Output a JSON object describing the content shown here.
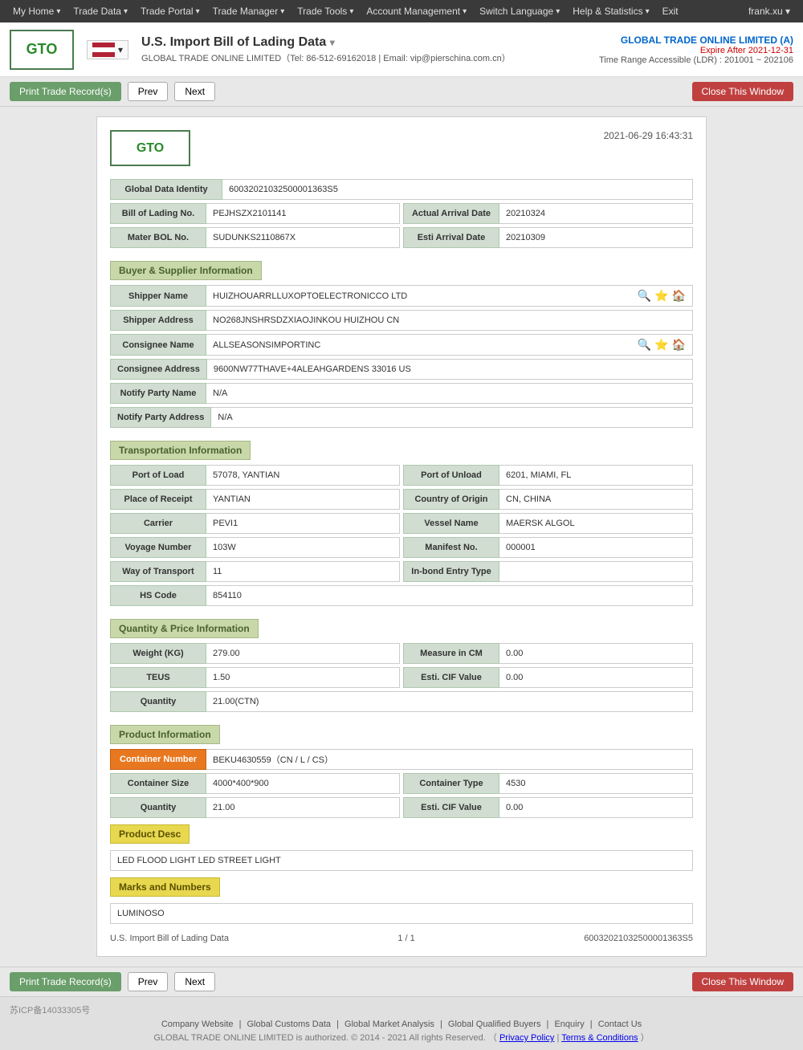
{
  "nav": {
    "items": [
      {
        "label": "My Home",
        "id": "my-home"
      },
      {
        "label": "Trade Data",
        "id": "trade-data"
      },
      {
        "label": "Trade Portal",
        "id": "trade-portal"
      },
      {
        "label": "Trade Manager",
        "id": "trade-manager"
      },
      {
        "label": "Trade Tools",
        "id": "trade-tools"
      },
      {
        "label": "Account Management",
        "id": "account-management"
      },
      {
        "label": "Switch Language",
        "id": "switch-language"
      },
      {
        "label": "Help & Statistics",
        "id": "help-statistics"
      },
      {
        "label": "Exit",
        "id": "exit"
      }
    ],
    "user": "frank.xu ▾"
  },
  "header": {
    "logo_line1": "GTO",
    "logo_line2": "GLOBAL TRADE\nONLINE LIMITED",
    "title": "U.S. Import Bill of Lading Data",
    "subtitle": "GLOBAL TRADE ONLINE LIMITED（Tel: 86-512-69162018 | Email: vip@pierschina.com.cn）",
    "company": "GLOBAL TRADE ONLINE LIMITED (A)",
    "expire": "Expire After 2021-12-31",
    "time_range": "Time Range Accessible (LDR) : 201001 ~ 202106"
  },
  "toolbar": {
    "print_label": "Print Trade Record(s)",
    "prev_label": "Prev",
    "next_label": "Next",
    "close_label": "Close This Window"
  },
  "record": {
    "date": "2021-06-29 16:43:31",
    "global_data_identity_label": "Global Data Identity",
    "global_data_identity_value": "60032021032500001363S5",
    "bill_of_lading_no_label": "Bill of Lading No.",
    "bill_of_lading_no_value": "PEJHSZX2101141",
    "actual_arrival_date_label": "Actual Arrival Date",
    "actual_arrival_date_value": "20210324",
    "mater_bol_no_label": "Mater BOL No.",
    "mater_bol_no_value": "SUDUNKS2110867X",
    "esti_arrival_date_label": "Esti Arrival Date",
    "esti_arrival_date_value": "20210309",
    "sections": {
      "buyer_supplier": "Buyer & Supplier Information",
      "transportation": "Transportation Information",
      "quantity_price": "Quantity & Price Information",
      "product": "Product Information"
    },
    "shipper_name_label": "Shipper Name",
    "shipper_name_value": "HUIZHOUARRLLUXOPTOELECTRONICCO LTD",
    "shipper_address_label": "Shipper Address",
    "shipper_address_value": "NO268JNSHRSDZXIAOJINKOU HUIZHOU CN",
    "consignee_name_label": "Consignee Name",
    "consignee_name_value": "ALLSEASONSIMPORTINC",
    "consignee_address_label": "Consignee Address",
    "consignee_address_value": "9600NW77THAVE+4ALEAHGARDENS 33016 US",
    "notify_party_name_label": "Notify Party Name",
    "notify_party_name_value": "N/A",
    "notify_party_address_label": "Notify Party Address",
    "notify_party_address_value": "N/A",
    "port_of_load_label": "Port of Load",
    "port_of_load_value": "57078, YANTIAN",
    "port_of_unload_label": "Port of Unload",
    "port_of_unload_value": "6201, MIAMI, FL",
    "place_of_receipt_label": "Place of Receipt",
    "place_of_receipt_value": "YANTIAN",
    "country_of_origin_label": "Country of Origin",
    "country_of_origin_value": "CN, CHINA",
    "carrier_label": "Carrier",
    "carrier_value": "PEVI1",
    "vessel_name_label": "Vessel Name",
    "vessel_name_value": "MAERSK ALGOL",
    "voyage_number_label": "Voyage Number",
    "voyage_number_value": "103W",
    "manifest_no_label": "Manifest No.",
    "manifest_no_value": "000001",
    "way_of_transport_label": "Way of Transport",
    "way_of_transport_value": "11",
    "in_bond_entry_type_label": "In-bond Entry Type",
    "in_bond_entry_type_value": "",
    "hs_code_label": "HS Code",
    "hs_code_value": "854110",
    "weight_kg_label": "Weight (KG)",
    "weight_kg_value": "279.00",
    "measure_in_cm_label": "Measure in CM",
    "measure_in_cm_value": "0.00",
    "teus_label": "TEUS",
    "teus_value": "1.50",
    "esti_cif_value_label": "Esti. CIF Value",
    "esti_cif_value_1": "0.00",
    "quantity_label": "Quantity",
    "quantity_value": "21.00(CTN)",
    "container_number_label": "Container Number",
    "container_number_value": "BEKU4630559（CN / L / CS）",
    "container_size_label": "Container Size",
    "container_size_value": "4000*400*900",
    "container_type_label": "Container Type",
    "container_type_value": "4530",
    "quantity2_label": "Quantity",
    "quantity2_value": "21.00",
    "esti_cif_value2_label": "Esti. CIF Value",
    "esti_cif_value2_value": "0.00",
    "product_desc_label": "Product Desc",
    "product_desc_value": "LED FLOOD LIGHT LED STREET LIGHT",
    "marks_numbers_label": "Marks and Numbers",
    "marks_numbers_value": "LUMINOSO",
    "footer_title": "U.S. Import Bill of Lading Data",
    "footer_page": "1 / 1",
    "footer_id": "60032021032500001363S5"
  },
  "bottom_toolbar": {
    "print_label": "Print Trade Record(s)",
    "prev_label": "Prev",
    "next_label": "Next",
    "close_label": "Close This Window"
  },
  "footer": {
    "icp": "苏ICP备14033305号",
    "links": [
      {
        "label": "Company Website",
        "url": "#"
      },
      {
        "label": "Global Customs Data",
        "url": "#"
      },
      {
        "label": "Global Market Analysis",
        "url": "#"
      },
      {
        "label": "Global Qualified Buyers",
        "url": "#"
      },
      {
        "label": "Enquiry",
        "url": "#"
      },
      {
        "label": "Contact Us",
        "url": "#"
      }
    ],
    "copyright": "GLOBAL TRADE ONLINE LIMITED is authorized. © 2014 - 2021 All rights Reserved. （",
    "privacy": "Privacy Policy",
    "terms": "Terms & Conditions",
    "copyright_end": "）"
  },
  "icons": {
    "search": "🔍",
    "star": "⭐",
    "home": "🏠",
    "dropdown": "▾"
  }
}
